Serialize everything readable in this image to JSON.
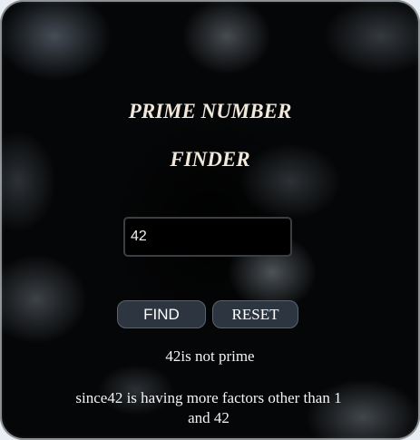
{
  "header": {
    "title_line1": "PRIME NUMBER",
    "title_line2": "FINDER"
  },
  "input": {
    "value": "42"
  },
  "buttons": {
    "find_label": "FIND",
    "reset_label": "RESET"
  },
  "output": {
    "result": "42is not prime",
    "reason": "since42 is having more factors other than 1 and 42"
  },
  "colors": {
    "title": "#f1e8dc",
    "button_bg": "#2d3540",
    "text": "#f4f4f4"
  }
}
